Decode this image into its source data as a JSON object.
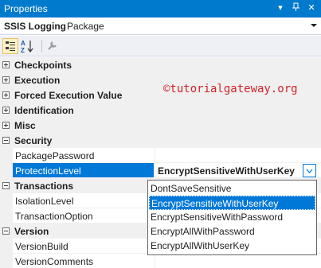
{
  "window": {
    "title": "Properties"
  },
  "object_selector": {
    "name": "SSIS Logging",
    "type": "Package"
  },
  "toolbar": {
    "buttons": [
      "categorized-icon",
      "alphabetical-icon",
      "property-pages-icon"
    ]
  },
  "watermark": "©tutorialgateway.org",
  "categories": [
    {
      "label": "Checkpoints",
      "expanded": false
    },
    {
      "label": "Execution",
      "expanded": false
    },
    {
      "label": "Forced Execution Value",
      "expanded": false
    },
    {
      "label": "Identification",
      "expanded": false
    },
    {
      "label": "Misc",
      "expanded": false
    },
    {
      "label": "Security",
      "expanded": true,
      "properties": [
        {
          "name": "PackagePassword",
          "value": ""
        },
        {
          "name": "ProtectionLevel",
          "value": "EncryptSensitiveWithUserKey"
        }
      ]
    },
    {
      "label": "Transactions",
      "expanded": true,
      "properties": [
        {
          "name": "IsolationLevel",
          "value": ""
        },
        {
          "name": "TransactionOption",
          "value": ""
        }
      ]
    },
    {
      "label": "Version",
      "expanded": true,
      "properties": [
        {
          "name": "VersionBuild",
          "value": ""
        },
        {
          "name": "VersionComments",
          "value": ""
        }
      ]
    }
  ],
  "protection_dropdown": {
    "selected": "EncryptSensitiveWithUserKey",
    "options": [
      "DontSaveSensitive",
      "EncryptSensitiveWithUserKey",
      "EncryptSensitiveWithPassword",
      "EncryptAllWithPassword",
      "EncryptAllWithUserKey"
    ]
  },
  "colors": {
    "titlebar": "#007acc",
    "selection": "#0078d7",
    "category_bg": "#f0f0f0",
    "watermark": "#d2232a"
  }
}
